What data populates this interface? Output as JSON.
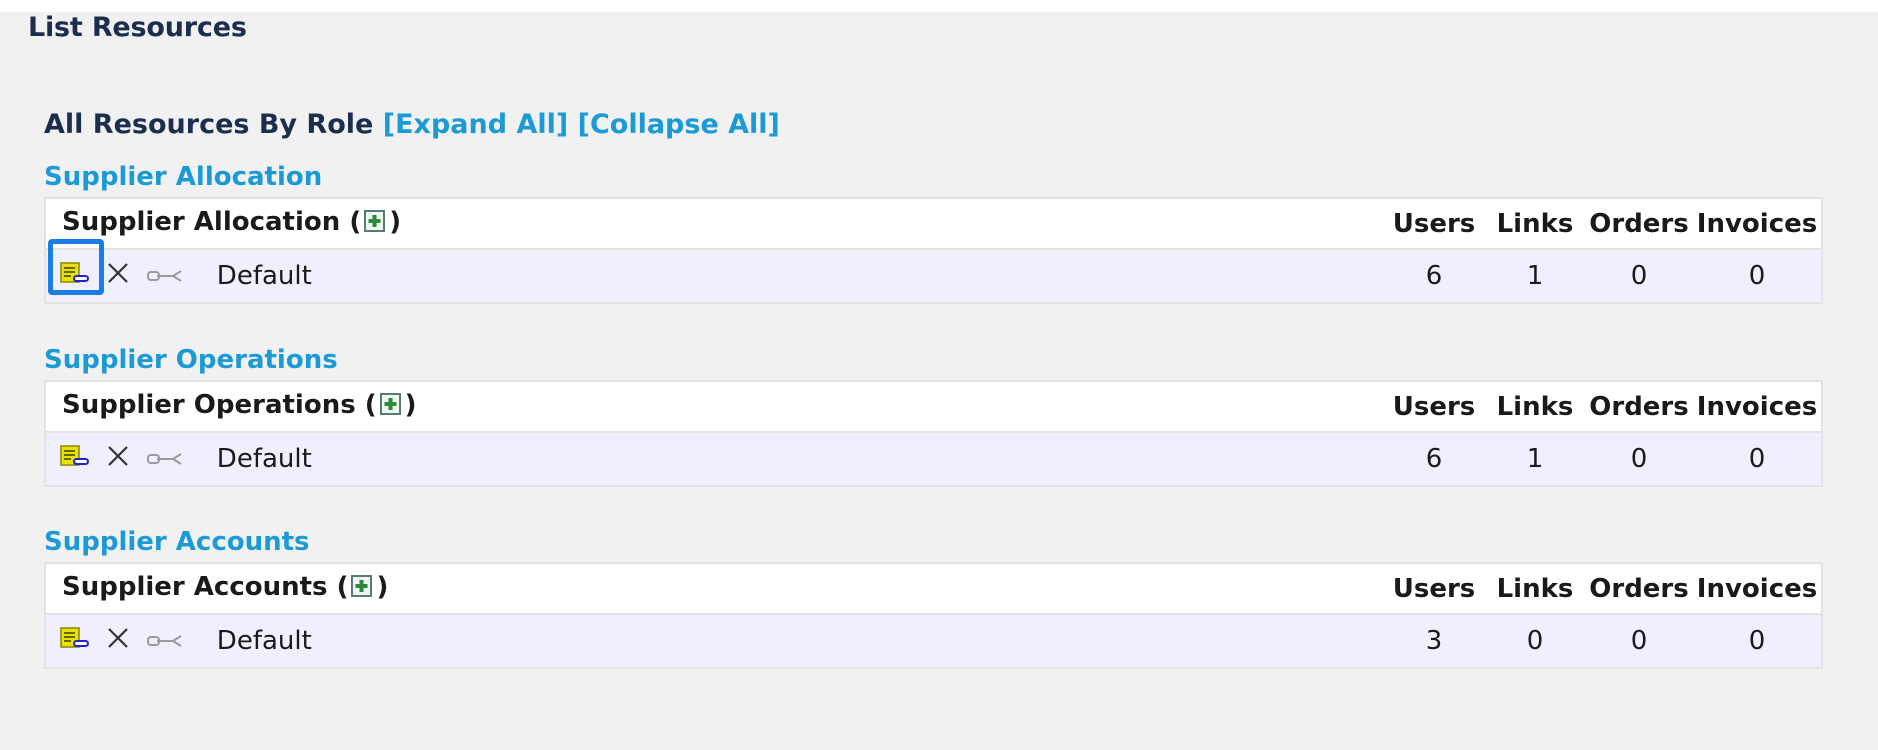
{
  "page": {
    "title": "List Resources"
  },
  "heading": {
    "label": "All Resources By Role",
    "expand_all": "[Expand All]",
    "collapse_all": "[Collapse All]"
  },
  "columns": {
    "users": "Users",
    "links": "Links",
    "orders": "Orders",
    "invoices": "Invoices"
  },
  "groups": [
    {
      "link": "Supplier Allocation",
      "header": "Supplier Allocation (",
      "row": {
        "name": "Default",
        "users": "6",
        "links": "1",
        "orders": "0",
        "invoices": "0"
      }
    },
    {
      "link": "Supplier Operations",
      "header": "Supplier Operations (",
      "row": {
        "name": "Default",
        "users": "6",
        "links": "1",
        "orders": "0",
        "invoices": "0"
      }
    },
    {
      "link": "Supplier Accounts",
      "header": "Supplier Accounts (",
      "row": {
        "name": "Default",
        "users": "3",
        "links": "0",
        "orders": "0",
        "invoices": "0"
      }
    }
  ],
  "punct": {
    "close_paren": ")"
  },
  "icons": {
    "add": "add-resource-icon",
    "edit": "edit-resource-icon",
    "delete": "delete-icon",
    "link": "link-icon"
  },
  "colors": {
    "link": "#1c9ad6",
    "row_bg": "#efeffd",
    "focus": "#1a7de6",
    "title": "#1c2d4d"
  }
}
